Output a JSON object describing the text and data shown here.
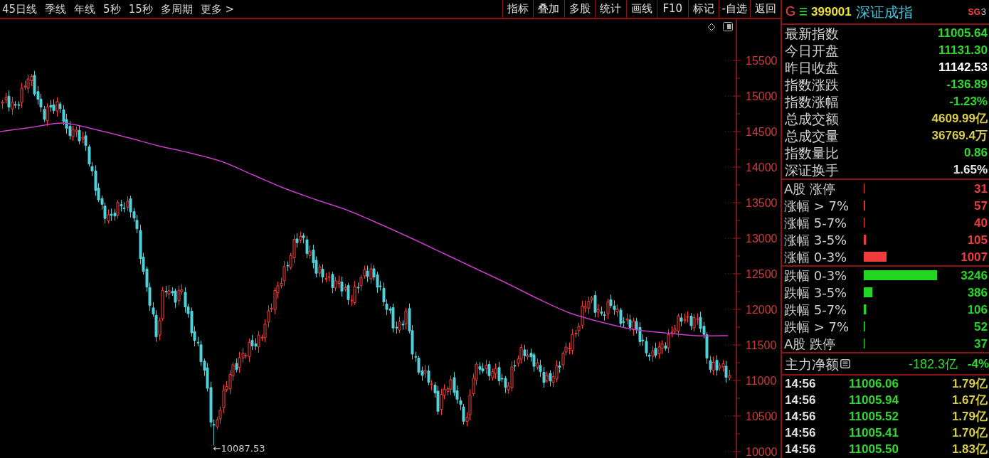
{
  "toolbar": {
    "periods": [
      {
        "label": "45日线",
        "selected": false
      },
      {
        "label": "季线",
        "selected": false
      },
      {
        "label": "年线",
        "selected": false
      },
      {
        "label": "5秒",
        "selected": false
      },
      {
        "label": "15秒",
        "selected": false
      },
      {
        "label": "多周期",
        "selected": false
      },
      {
        "label": "更多 >",
        "selected": false
      }
    ],
    "tools": [
      "指标",
      "叠加",
      "多股",
      "统计",
      "画线",
      "F10",
      "标记",
      "-自选",
      "返回"
    ]
  },
  "chart": {
    "chart_data": {
      "type": "line",
      "ylim": [
        9910,
        16080
      ],
      "yticks": [
        15500,
        15000,
        14500,
        14000,
        13500,
        13000,
        12500,
        12000,
        11500,
        11000,
        10500,
        10000
      ],
      "series": [
        {
          "color": "#c83cc8",
          "values": [
            14500,
            14560,
            14620,
            14530,
            14420,
            14300,
            14200,
            14080,
            13890,
            13700,
            13540,
            13390,
            13200,
            13000,
            12790,
            12580,
            12370,
            12150,
            11950,
            11820,
            11720,
            11670,
            11630,
            11630
          ]
        }
      ],
      "annotations": [
        "←10087.53"
      ]
    }
  },
  "quote": {
    "prefix": "G",
    "code": "399001",
    "name": "深证成指",
    "sg_label": "SG",
    "sg_count": "3"
  },
  "stats": [
    {
      "label": "最新指数",
      "value": "11005.64",
      "color": "#2fd82f"
    },
    {
      "label": "今日开盘",
      "value": "11131.30",
      "color": "#2fd82f"
    },
    {
      "label": "昨日收盘",
      "value": "11142.53",
      "color": "#ffffff"
    },
    {
      "label": "指数涨跌",
      "value": "-136.89",
      "color": "#2fd82f"
    },
    {
      "label": "指数涨幅",
      "value": "-1.23%",
      "color": "#2fd82f"
    },
    {
      "label": "总成交额",
      "value": "4609.99亿",
      "color": "#d6cc45"
    },
    {
      "label": "总成交量",
      "value": "36769.4万",
      "color": "#d6cc45"
    },
    {
      "label": "指数量比",
      "value": "0.86",
      "color": "#2fd82f"
    },
    {
      "label": "深证换手",
      "value": "1.65%",
      "color": "#e6e6e6"
    }
  ],
  "advances": {
    "chart_data": {
      "type": "bar",
      "orientation": "horizontal",
      "data_labels": true,
      "categories": [
        "A股 涨停",
        "涨幅 > 7%",
        "涨幅 5-7%",
        "涨幅 3-5%",
        "涨幅 0-3%"
      ],
      "series": [
        {
          "color": "#ee3c3c",
          "values": [
            31,
            57,
            40,
            105,
            1007
          ]
        }
      ]
    }
  },
  "declines": {
    "chart_data": {
      "type": "bar",
      "orientation": "horizontal",
      "data_labels": true,
      "categories": [
        "跌幅 0-3%",
        "跌幅 3-5%",
        "跌幅 5-7%",
        "跌幅 > 7%",
        "A股 跌停"
      ],
      "series": [
        {
          "color": "#22d822",
          "values": [
            3246,
            386,
            106,
            52,
            37
          ]
        }
      ]
    }
  },
  "main_flow": {
    "label": "主力净额",
    "amount": "-182.3亿",
    "percent": "-4%"
  },
  "ticks": [
    {
      "time": "14:56",
      "price": "11006.06",
      "volume": "1.79亿"
    },
    {
      "time": "14:56",
      "price": "11005.94",
      "volume": "1.67亿"
    },
    {
      "time": "14:56",
      "price": "11005.52",
      "volume": "1.79亿"
    },
    {
      "time": "14:56",
      "price": "11005.41",
      "volume": "1.70亿"
    },
    {
      "time": "14:56",
      "price": "11005.50",
      "volume": "1.83亿"
    }
  ]
}
